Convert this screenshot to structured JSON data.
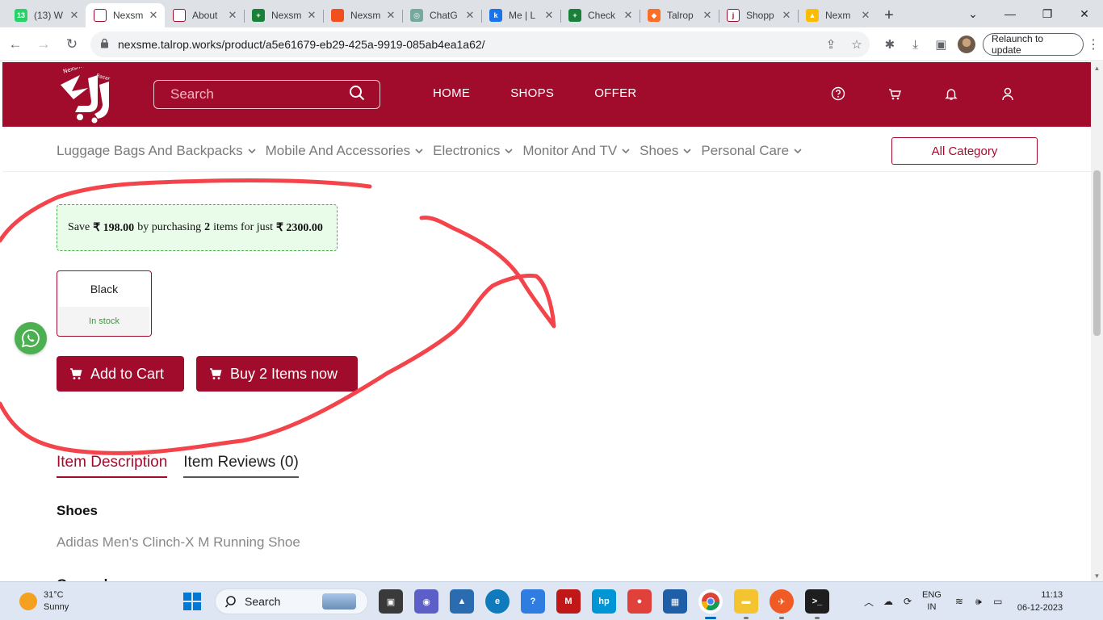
{
  "browser": {
    "tabs": [
      {
        "label": "(13) W",
        "color": "#25d366",
        "glyph": "13"
      },
      {
        "label": "Nexsm",
        "color": "#ffffff",
        "glyph": "",
        "active": true
      },
      {
        "label": "About",
        "color": "#ffffff",
        "glyph": ""
      },
      {
        "label": "Nexsm",
        "color": "#188038",
        "glyph": "+"
      },
      {
        "label": "Nexsm",
        "color": "#f24e1e",
        "glyph": ""
      },
      {
        "label": "ChatG",
        "color": "#74aa9c",
        "glyph": "◎"
      },
      {
        "label": "Me | L",
        "color": "#1a73e8",
        "glyph": "k"
      },
      {
        "label": "Check",
        "color": "#188038",
        "glyph": "+"
      },
      {
        "label": "Talrop",
        "color": "#fc6d26",
        "glyph": "◆"
      },
      {
        "label": "Shopp",
        "color": "#ffffff",
        "glyph": "j"
      },
      {
        "label": "Nexm",
        "color": "#fbbc04",
        "glyph": "▲"
      }
    ],
    "url": "nexsme.talrop.works/product/a5e61679-eb29-425a-9919-085ab4ea1a62/",
    "relaunch_label": "Relaunch to update"
  },
  "site": {
    "search_placeholder": "Search",
    "nav": [
      "HOME",
      "SHOPS",
      "OFFER"
    ],
    "categories": [
      "Luggage Bags And Backpacks",
      "Mobile And Accessories",
      "Electronics",
      "Monitor And TV",
      "Shoes",
      "Personal Care"
    ],
    "all_category_label": "All Category",
    "brand_color": "#a20c2c"
  },
  "product": {
    "offer": {
      "prefix": "Save",
      "save_amount": "₹ 198.00",
      "middle": "by purchasing",
      "qty": "2",
      "middle2": "items for just",
      "total": "₹ 2300.00"
    },
    "variant": {
      "name": "Black",
      "stock": "In stock"
    },
    "add_to_cart_label": "Add to Cart",
    "buy_now_label": "Buy 2 Items now",
    "tabs": [
      "Item Description",
      "Item Reviews (0)"
    ],
    "spec_title": "Shoes",
    "spec_value": "Adidas Men's Clinch-X M Running Shoe",
    "next_section": "General"
  },
  "taskbar": {
    "weather_temp": "31°C",
    "weather_desc": "Sunny",
    "search_label": "Search",
    "lang_line1": "ENG",
    "lang_line2": "IN",
    "time": "11:13",
    "date": "06-12-2023"
  }
}
